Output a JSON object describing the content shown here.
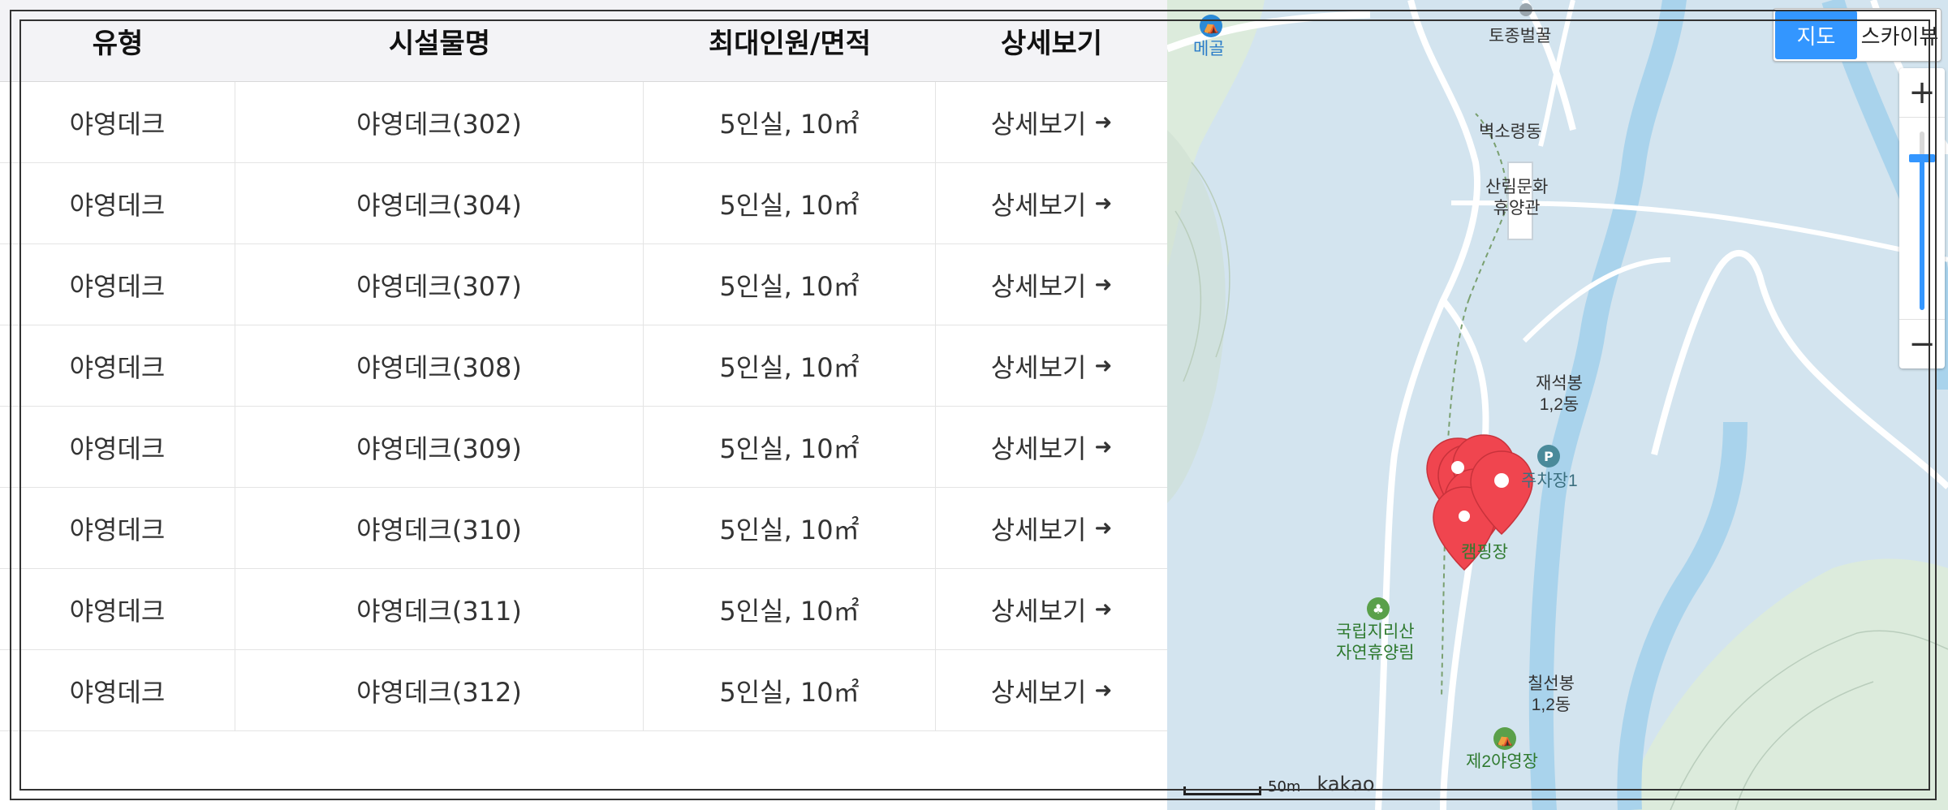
{
  "table": {
    "headers": [
      "유형",
      "시설물명",
      "최대인원/면적",
      "상세보기"
    ],
    "rows": [
      {
        "type": "야영데크",
        "name": "야영데크(302)",
        "capacity": "5인실, 10㎡",
        "detail": "상세보기"
      },
      {
        "type": "야영데크",
        "name": "야영데크(304)",
        "capacity": "5인실, 10㎡",
        "detail": "상세보기"
      },
      {
        "type": "야영데크",
        "name": "야영데크(307)",
        "capacity": "5인실, 10㎡",
        "detail": "상세보기"
      },
      {
        "type": "야영데크",
        "name": "야영데크(308)",
        "capacity": "5인실, 10㎡",
        "detail": "상세보기"
      },
      {
        "type": "야영데크",
        "name": "야영데크(309)",
        "capacity": "5인실, 10㎡",
        "detail": "상세보기"
      },
      {
        "type": "야영데크",
        "name": "야영데크(310)",
        "capacity": "5인실, 10㎡",
        "detail": "상세보기"
      },
      {
        "type": "야영데크",
        "name": "야영데크(311)",
        "capacity": "5인실, 10㎡",
        "detail": "상세보기"
      },
      {
        "type": "야영데크",
        "name": "야영데크(312)",
        "capacity": "5인실, 10㎡",
        "detail": "상세보기"
      }
    ],
    "arrow_icon": "arrow-right-icon"
  },
  "map": {
    "type_toggle": {
      "map": "지도",
      "skyview": "스카이뷰",
      "selected": "지도"
    },
    "zoom": {
      "in": "+",
      "out": "−",
      "level_fraction": 0.85
    },
    "labels": {
      "megol": "메골",
      "tojong": "토종벌꿀",
      "byeoksoryeong": "벽소령동",
      "sanrim_1": "산림문화",
      "sanrim_2": "휴양관",
      "jaeseokbong_1": "재석봉",
      "jaeseokbong_2": "1,2동",
      "parking": "주차장1",
      "parking_icon": "P",
      "camping": "캠핑장",
      "forest_1": "국립지리산",
      "forest_2": "자연휴양림",
      "chilseonbong_1": "칠선봉",
      "chilseonbong_2": "1,2동",
      "campsite2": "제2야영장"
    },
    "scale": "50m",
    "brand": "kakao",
    "marker_color": "#f0454f"
  }
}
